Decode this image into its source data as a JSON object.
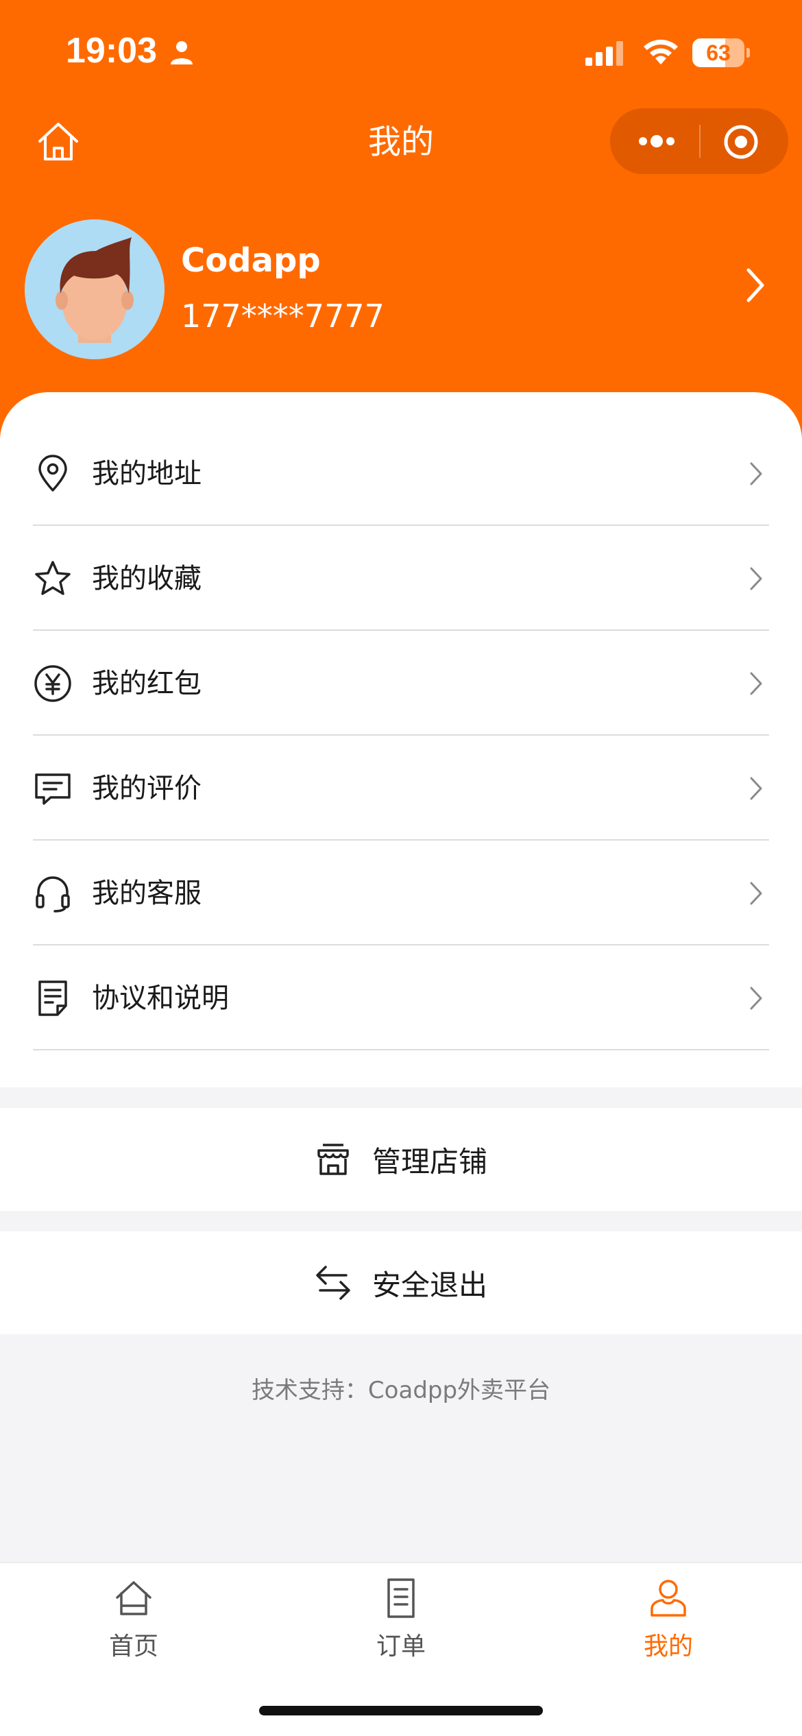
{
  "status_bar": {
    "time": "19:03",
    "battery_level": 63,
    "battery_text": "63"
  },
  "nav": {
    "title": "我的"
  },
  "profile": {
    "name": "Codapp",
    "phone": "177****7777"
  },
  "menu": [
    {
      "icon": "location-pin-icon",
      "label": "我的地址"
    },
    {
      "icon": "star-icon",
      "label": "我的收藏"
    },
    {
      "icon": "yen-coin-icon",
      "label": "我的红包"
    },
    {
      "icon": "comment-icon",
      "label": "我的评价"
    },
    {
      "icon": "headset-icon",
      "label": "我的客服"
    },
    {
      "icon": "document-icon",
      "label": "协议和说明"
    }
  ],
  "actions": {
    "manage_store": "管理店铺",
    "logout": "安全退出"
  },
  "footer": {
    "credit": "技术支持：Coadpp外卖平台"
  },
  "tab_bar": {
    "tabs": [
      {
        "label": "首页",
        "icon": "home-icon",
        "active": false
      },
      {
        "label": "订单",
        "icon": "order-icon",
        "active": false
      },
      {
        "label": "我的",
        "icon": "user-icon",
        "active": true
      }
    ]
  },
  "colors": {
    "brand": "#ff6a00",
    "background": "#f4f4f6",
    "text": "#1a1a1a",
    "muted": "#7a7a7a"
  }
}
